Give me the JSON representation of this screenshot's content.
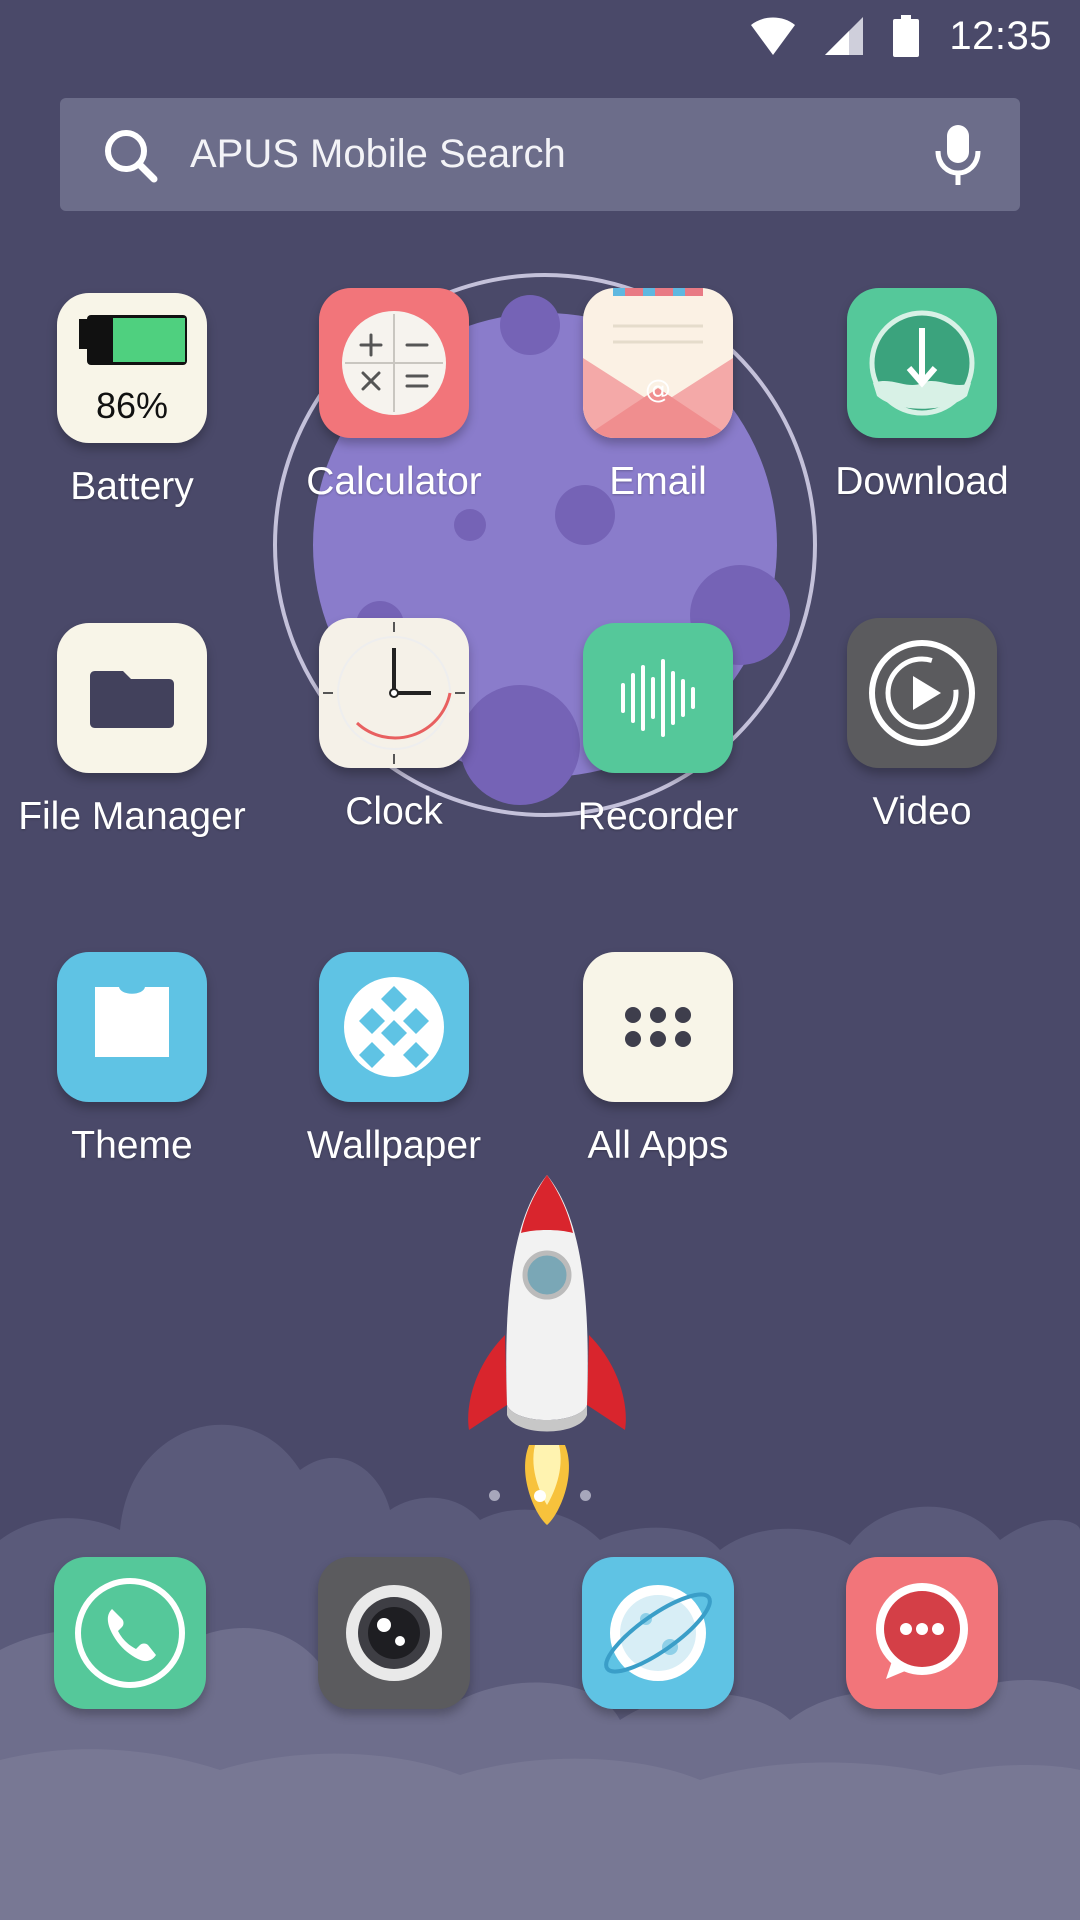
{
  "status_bar": {
    "time": "12:35",
    "icons": [
      "wifi-icon",
      "cell-signal-icon",
      "battery-icon"
    ]
  },
  "search": {
    "placeholder": "APUS Mobile Search",
    "left_icon": "search-icon",
    "right_icon": "microphone-icon"
  },
  "apps": [
    {
      "label": "Battery",
      "icon": "battery-icon",
      "badge": "86%",
      "level": 0.86
    },
    {
      "label": "Calculator",
      "icon": "calculator-icon"
    },
    {
      "label": "Email",
      "icon": "email-icon"
    },
    {
      "label": "Download",
      "icon": "download-icon"
    },
    {
      "label": "File Manager",
      "icon": "folder-icon"
    },
    {
      "label": "Clock",
      "icon": "clock-icon"
    },
    {
      "label": "Recorder",
      "icon": "sound-wave-icon"
    },
    {
      "label": "Video",
      "icon": "play-icon"
    },
    {
      "label": "Theme",
      "icon": "tshirt-icon"
    },
    {
      "label": "Wallpaper",
      "icon": "diamond-pattern-icon"
    },
    {
      "label": "All Apps",
      "icon": "app-grid-icon"
    }
  ],
  "dock": [
    {
      "name": "phone",
      "icon": "phone-icon"
    },
    {
      "name": "camera",
      "icon": "camera-icon"
    },
    {
      "name": "browser",
      "icon": "planet-icon"
    },
    {
      "name": "messages",
      "icon": "chat-bubble-icon"
    }
  ],
  "pager": {
    "pages": 3,
    "current": 2
  },
  "colors": {
    "background": "#4a4969",
    "search_bar": "#6c6d8a",
    "moon": "#8a7ccb",
    "green": "#55c89a",
    "red": "#f2757a",
    "blue": "#5fc3e4",
    "dark_grey": "#5b5b5e",
    "cream": "#f8f5e8"
  }
}
